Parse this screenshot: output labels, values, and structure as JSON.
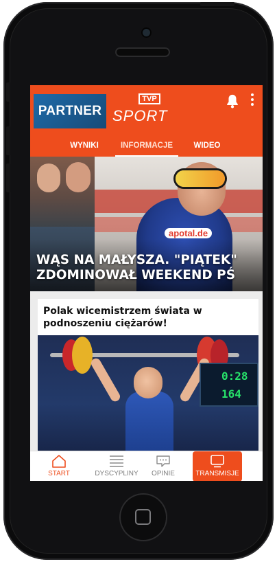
{
  "header": {
    "partner_label": "PARTNER",
    "logo_box": "TVP",
    "logo_word": "SPORT"
  },
  "tabs": [
    {
      "label": "WYNIKI"
    },
    {
      "label": "INFORMACJE"
    },
    {
      "label": "WIDEO"
    }
  ],
  "hero": {
    "title_line1": "WĄS NA MAŁYSZA. \"PIĄTEK\"",
    "title_line2": "ZDOMINOWAŁ WEEKEND PŚ",
    "sponsor": "apotal.de"
  },
  "article": {
    "title": "Polak wicemistrzem świata w podnoszeniu ciężarów!",
    "scoreboard_line1": "0:28",
    "scoreboard_line2": "164"
  },
  "bottom_nav": [
    {
      "label": "START",
      "icon": "home-icon"
    },
    {
      "label": "DYSCYPLINY",
      "icon": "list-icon"
    },
    {
      "label": "OPINIE",
      "icon": "chat-icon"
    },
    {
      "label": "TRANSMISJE",
      "icon": "tv-icon"
    }
  ],
  "colors": {
    "brand": "#ee4d1d",
    "partner_bg": "#1c5b91"
  }
}
